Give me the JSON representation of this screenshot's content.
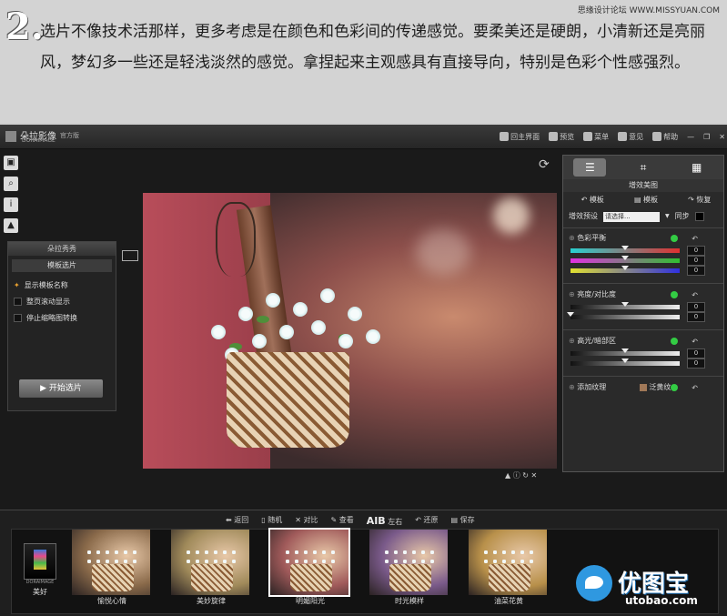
{
  "article": {
    "step_number": "2.",
    "paragraph": "选片不像技术活那样，更多考虑是在颜色和色彩间的传递感觉。要柔美还是硬朗，小清新还是亮丽风，梦幻多一些还是轻浅淡然的感觉。拿捏起来主观感具有直接导向，特别是色彩个性感强烈。",
    "watermark_top": "思缘设计论坛  WWW.MISSYUAN.COM"
  },
  "titlebar": {
    "app_name": "朵拉影像",
    "app_sub": "DORAIMAGE",
    "edition": "官方版",
    "items": [
      "回主界面",
      "预览",
      "菜单",
      "意见",
      "帮助"
    ]
  },
  "left_tools": [
    "histogram-icon",
    "zoom-icon",
    "info-icon",
    "levels-icon"
  ],
  "left_panel": {
    "header": "朵拉秀秀",
    "subheader": "模板选片",
    "options": [
      {
        "label": "显示模板名称",
        "marker": "star"
      },
      {
        "label": "整页滚动显示",
        "marker": "checkbox"
      },
      {
        "label": "停止缩略图转换",
        "marker": "checkbox"
      }
    ],
    "start_button": "开始选片"
  },
  "right_panel": {
    "title": "增效美图",
    "template_buttons": [
      "模板",
      "模板",
      "恢复"
    ],
    "preset_label": "增效预设",
    "preset_value": "请选择...",
    "sync_label": "同步",
    "sections": [
      {
        "title": "色彩平衡",
        "sliders": [
          {
            "colors": [
              "#28d0d0",
              "#e03030"
            ],
            "value": "0",
            "pos": 0.5
          },
          {
            "colors": [
              "#e030e0",
              "#30c030"
            ],
            "value": "0",
            "pos": 0.5
          },
          {
            "colors": [
              "#e0e030",
              "#3030e0"
            ],
            "value": "0",
            "pos": 0.5
          }
        ]
      },
      {
        "title": "亮度/对比度",
        "sliders": [
          {
            "colors": [
              "#111111",
              "#eeeeee"
            ],
            "value": "0",
            "pos": 0.5
          },
          {
            "colors": [
              "#111111",
              "#eeeeee"
            ],
            "value": "0",
            "pos": 0.0
          }
        ]
      },
      {
        "title": "高光/暗部区",
        "sliders": [
          {
            "colors": [
              "#111111",
              "#eeeeee"
            ],
            "value": "0",
            "pos": 0.5
          },
          {
            "colors": [
              "#111111",
              "#eeeeee"
            ],
            "value": "0",
            "pos": 0.5
          }
        ]
      }
    ],
    "texture_label": "添加纹理",
    "texture_value": "泛黄纹"
  },
  "bottom_toolbar": [
    "返回",
    "随机",
    "对比",
    "查看",
    "左右",
    "还原",
    "保存"
  ],
  "bottom_ab": "AIB",
  "filmstrip": {
    "logo_text": "DORAIMAGE",
    "logo_label": "美好",
    "thumbs": [
      {
        "label": "愉悦心情",
        "tint": "#8a6a4a",
        "selected": false
      },
      {
        "label": "美妙旋律",
        "tint": "#a08a5a",
        "selected": false
      },
      {
        "label": "明媚阳光",
        "tint": "#a05a5a",
        "selected": true
      },
      {
        "label": "时光模样",
        "tint": "#7a5a8a",
        "selected": false
      },
      {
        "label": "油菜花黄",
        "tint": "#b8904a",
        "selected": false
      }
    ]
  },
  "watermark": {
    "cn": "优图宝",
    "en": "utobao.com"
  }
}
